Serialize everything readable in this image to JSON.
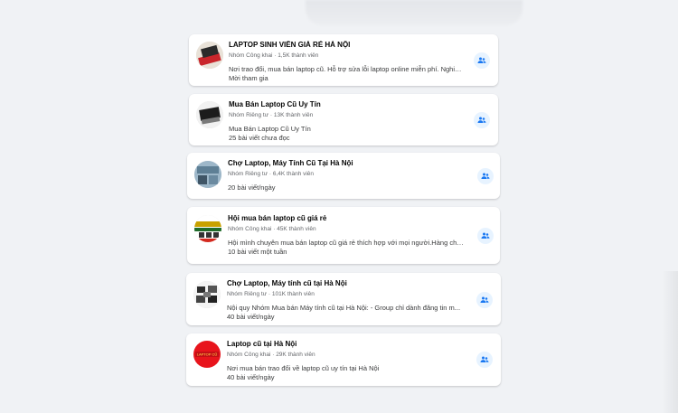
{
  "groups": [
    {
      "title": "LAPTOP SINH VIÊN GIÁ RẺ HÀ NỘI",
      "meta": "Nhóm Công khai · 1,5K thành viên",
      "desc": "Nơi trao đổi, mua bán laptop cũ. Hỗ trợ sửa lỗi laptop online miễn phí. Nghiê...",
      "activity": "Mời tham gia",
      "avatar": "laptop-photo"
    },
    {
      "title": "Mua Bán Laptop Cũ Uy Tín",
      "meta": "Nhóm Riêng tư · 13K thành viên",
      "desc": "Mua Bán Laptop Cũ Uy Tín",
      "activity": "25 bài viết chưa đọc",
      "avatar": "laptop-photo-dark"
    },
    {
      "title": "Chợ Laptop, Máy Tính Cũ Tại Hà Nội",
      "meta": "Nhóm Riêng tư · 6,4K thành viên",
      "desc": "",
      "activity": "20 bài viết/ngày",
      "avatar": "shop-photo"
    },
    {
      "title": "Hội mua bán laptop cũ giá rẻ",
      "meta": "Nhóm Công khai · 45K thành viên",
      "desc": "Hội mình chuyên mua bán laptop cũ giá rẻ thích hợp với mọi người.Hàng chất...",
      "activity": "10 bài viết một tuần",
      "avatar": "banner-photo"
    },
    {
      "title": "Chợ Laptop, Máy tính cũ tại Hà Nội",
      "meta": "Nhóm Riêng tư · 101K thành viên",
      "desc": "Nội quy Nhóm Mua bán Máy tính cũ tại Hà Nội: - Group chỉ dành đăng tin m...",
      "activity": "40 bài viết/ngày",
      "avatar": "collage-photo"
    },
    {
      "title": "Laptop cũ tại Hà Nội",
      "meta": "Nhóm Công khai · 29K thành viên",
      "desc": "Nơi mua bán trao đổi về laptop cũ uy tín tại Hà Nội",
      "activity": "40 bài viết/ngày",
      "avatar": "red-logo",
      "logo_text": "Laptop cũ tại Hà Nội"
    }
  ],
  "join_icon": "people-icon",
  "colors": {
    "accent": "#1877f2",
    "join_bg": "#e7f3ff",
    "background": "#f0f2f5"
  }
}
